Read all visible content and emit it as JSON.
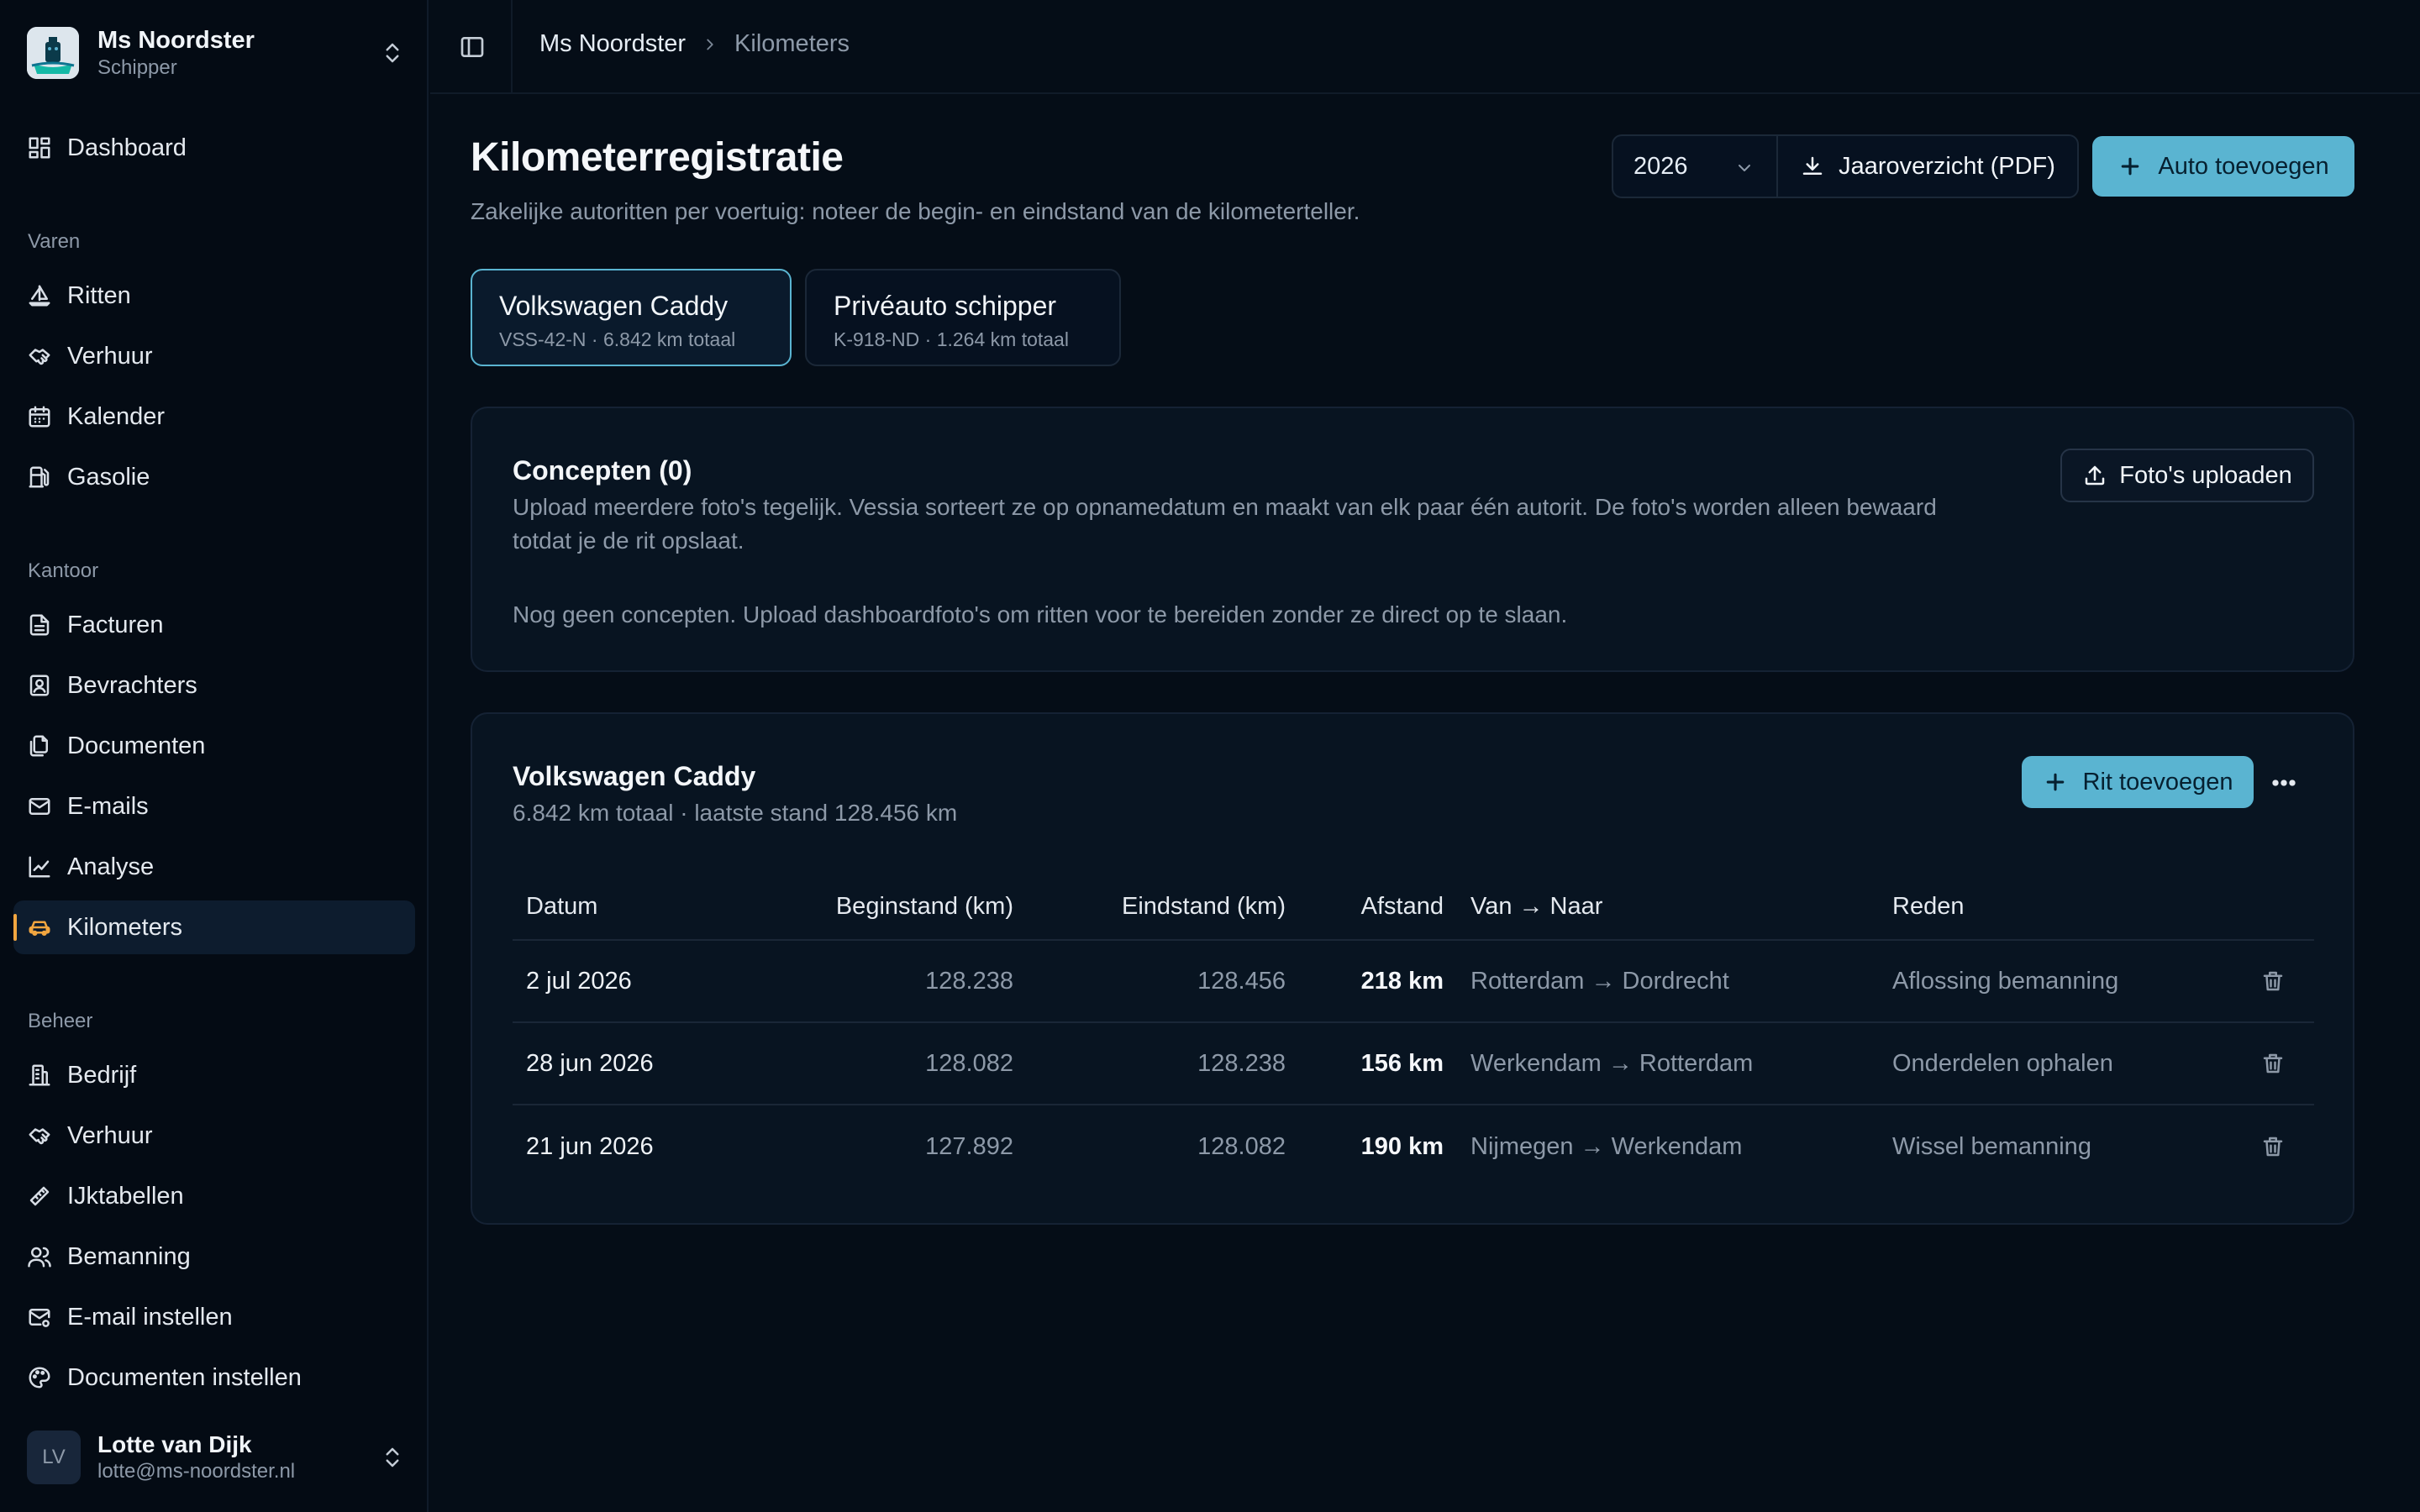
{
  "sidebar": {
    "brand": {
      "name": "Ms Noordster",
      "role": "Schipper"
    },
    "top_items": [
      {
        "label": "Dashboard"
      }
    ],
    "sections": [
      {
        "title": "Varen",
        "items": [
          {
            "label": "Ritten"
          },
          {
            "label": "Verhuur"
          },
          {
            "label": "Kalender"
          },
          {
            "label": "Gasolie"
          }
        ]
      },
      {
        "title": "Kantoor",
        "items": [
          {
            "label": "Facturen"
          },
          {
            "label": "Bevrachters"
          },
          {
            "label": "Documenten"
          },
          {
            "label": "E-mails"
          },
          {
            "label": "Analyse"
          },
          {
            "label": "Kilometers"
          }
        ]
      },
      {
        "title": "Beheer",
        "items": [
          {
            "label": "Bedrijf"
          },
          {
            "label": "Verhuur"
          },
          {
            "label": "IJktabellen"
          },
          {
            "label": "Bemanning"
          },
          {
            "label": "E-mail instellen"
          },
          {
            "label": "Documenten instellen"
          }
        ]
      }
    ],
    "active_item": "Kilometers",
    "user": {
      "initials": "LV",
      "name": "Lotte van Dijk",
      "email": "lotte@ms-noordster.nl"
    }
  },
  "breadcrumb": {
    "parent": "Ms Noordster",
    "current": "Kilometers"
  },
  "header": {
    "title": "Kilometerregistratie",
    "subtitle": "Zakelijke autoritten per voertuig: noteer de begin- en eindstand van de kilometerteller.",
    "year": "2026",
    "pdf_label": "Jaaroverzicht (PDF)",
    "add_car_label": "Auto toevoegen"
  },
  "vehicles": [
    {
      "name": "Volkswagen Caddy",
      "meta": "VSS-42-N · 6.842 km totaal",
      "active": true
    },
    {
      "name": "Privéauto schipper",
      "meta": "K-918-ND · 1.264 km totaal",
      "active": false
    }
  ],
  "concepts": {
    "title": "Concepten (0)",
    "description_line1": "Upload meerdere foto's tegelijk. Vessia sorteert ze op opnamedatum en maakt van elk paar één autorit. De foto's worden alleen bewaard",
    "description_line2": "totdat je de rit opslaat.",
    "empty": "Nog geen concepten. Upload dashboardfoto's om ritten voor te bereiden zonder ze direct op te slaan.",
    "upload_label": "Foto's uploaden"
  },
  "trips": {
    "title": "Volkswagen Caddy",
    "summary": "6.842 km totaal · laatste stand 128.456 km",
    "add_label": "Rit toevoegen",
    "columns": {
      "date": "Datum",
      "begin": "Beginstand (km)",
      "end": "Eindstand (km)",
      "distance": "Afstand",
      "route": "Van → Naar",
      "reason": "Reden"
    },
    "rows": [
      {
        "date": "2 jul 2026",
        "begin": "128.238",
        "end": "128.456",
        "distance": "218 km",
        "route": "Rotterdam → Dordrecht",
        "reason": "Aflossing bemanning"
      },
      {
        "date": "28 jun 2026",
        "begin": "128.082",
        "end": "128.238",
        "distance": "156 km",
        "route": "Werkendam → Rotterdam",
        "reason": "Onderdelen ophalen"
      },
      {
        "date": "21 jun 2026",
        "begin": "127.892",
        "end": "128.082",
        "distance": "190 km",
        "route": "Nijmegen → Werkendam",
        "reason": "Wissel bemanning"
      }
    ]
  },
  "colors": {
    "accent": "#5ab4d1",
    "active_nav_icon": "#f2a640",
    "background": "#050d17"
  }
}
